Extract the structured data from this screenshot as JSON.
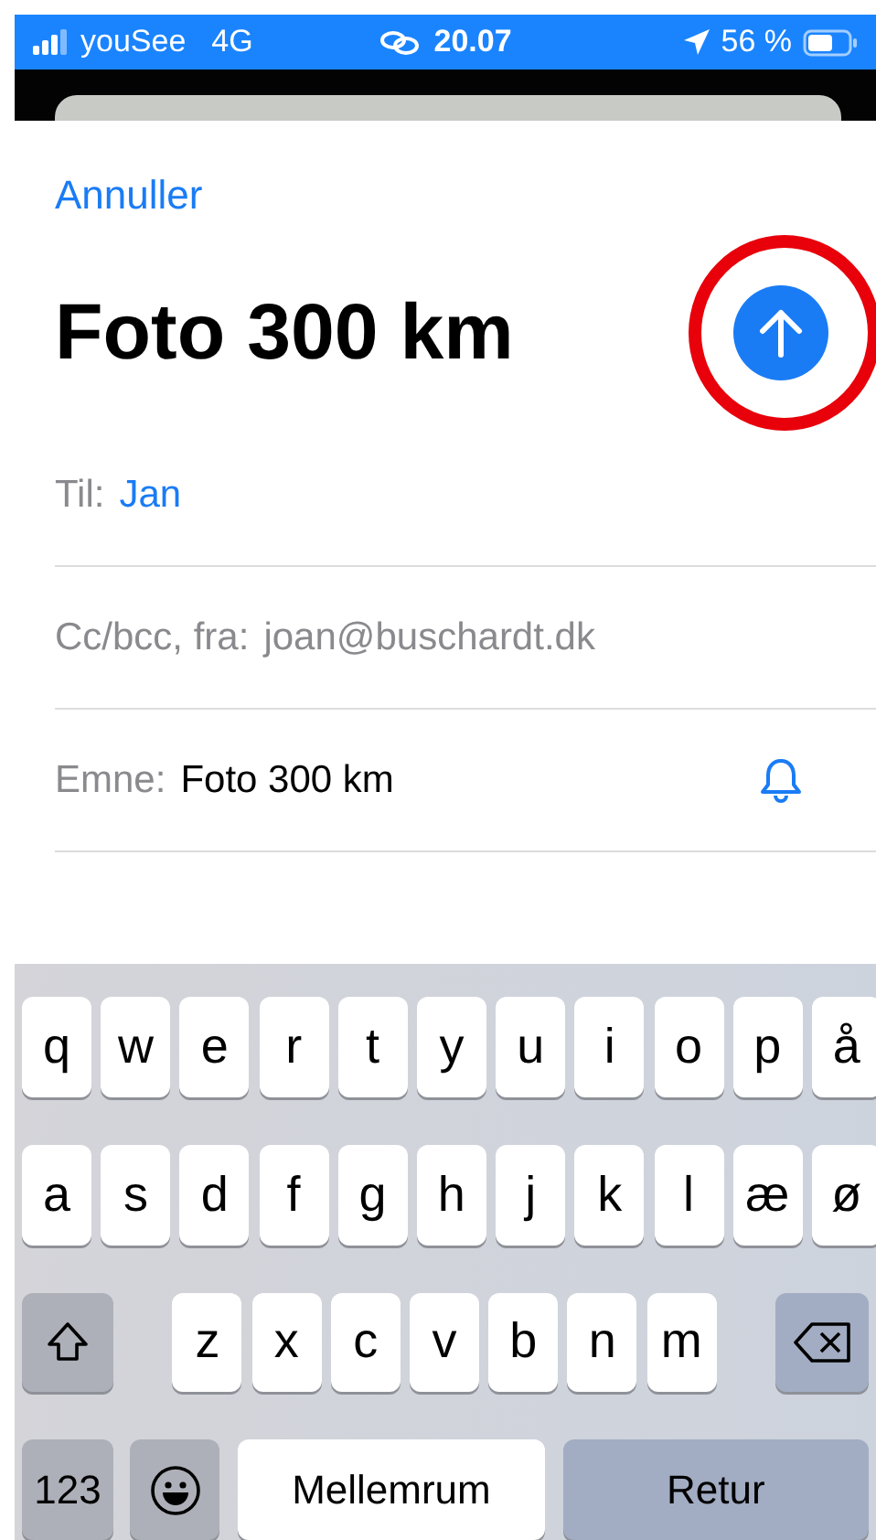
{
  "status_bar": {
    "carrier": "youSee",
    "network": "4G",
    "time": "20.07",
    "battery": "56 %"
  },
  "compose": {
    "cancel": "Annuller",
    "title": "Foto 300 km",
    "highlighted_send": true,
    "fields": [
      {
        "kind": "recipient",
        "label": "Til:",
        "value": "Jan"
      },
      {
        "kind": "sender",
        "label": "Cc/bcc, fra:",
        "value": "joan@buschardt.dk"
      },
      {
        "kind": "subject",
        "label": "Emne:",
        "value": "Foto 300 km"
      }
    ]
  },
  "keyboard": {
    "rows": [
      {
        "keys": [
          {
            "kind": "letter",
            "label": "q"
          },
          {
            "kind": "letter",
            "label": "w"
          },
          {
            "kind": "letter",
            "label": "e"
          },
          {
            "kind": "letter",
            "label": "r"
          },
          {
            "kind": "letter",
            "label": "t"
          },
          {
            "kind": "letter",
            "label": "y"
          },
          {
            "kind": "letter",
            "label": "u"
          },
          {
            "kind": "letter",
            "label": "i"
          },
          {
            "kind": "letter",
            "label": "o"
          },
          {
            "kind": "letter",
            "label": "p"
          },
          {
            "kind": "letter",
            "label": "å"
          }
        ]
      },
      {
        "keys": [
          {
            "kind": "letter",
            "label": "a"
          },
          {
            "kind": "letter",
            "label": "s"
          },
          {
            "kind": "letter",
            "label": "d"
          },
          {
            "kind": "letter",
            "label": "f"
          },
          {
            "kind": "letter",
            "label": "g"
          },
          {
            "kind": "letter",
            "label": "h"
          },
          {
            "kind": "letter",
            "label": "j"
          },
          {
            "kind": "letter",
            "label": "k"
          },
          {
            "kind": "letter",
            "label": "l"
          },
          {
            "kind": "letter",
            "label": "æ"
          },
          {
            "kind": "letter",
            "label": "ø"
          }
        ]
      },
      {
        "keys": [
          {
            "kind": "shift"
          },
          {
            "kind": "letter",
            "label": "z"
          },
          {
            "kind": "letter",
            "label": "x"
          },
          {
            "kind": "letter",
            "label": "c"
          },
          {
            "kind": "letter",
            "label": "v"
          },
          {
            "kind": "letter",
            "label": "b"
          },
          {
            "kind": "letter",
            "label": "n"
          },
          {
            "kind": "letter",
            "label": "m"
          },
          {
            "kind": "delete"
          }
        ]
      },
      {
        "keys": [
          {
            "kind": "numbers",
            "label": "123"
          },
          {
            "kind": "emoji"
          },
          {
            "kind": "space",
            "label": "Mellemrum"
          },
          {
            "kind": "return",
            "label": "Retur"
          }
        ]
      }
    ]
  }
}
